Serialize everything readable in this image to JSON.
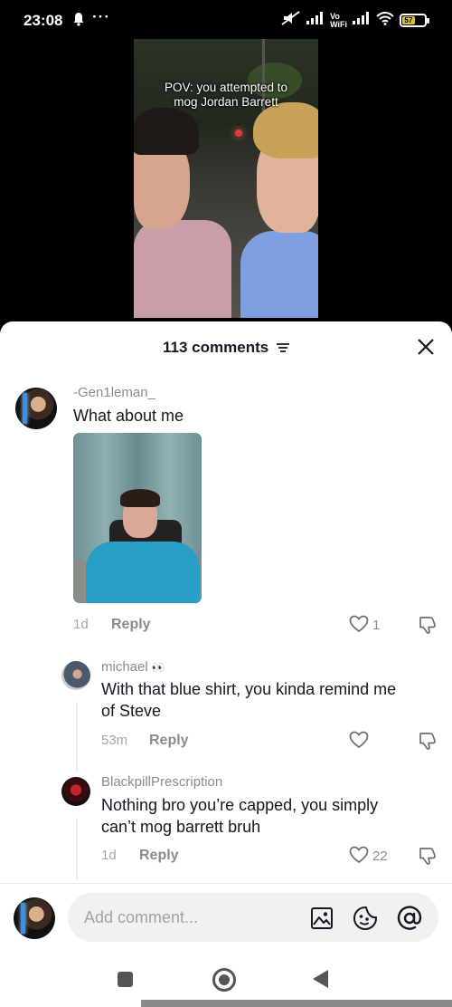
{
  "status_bar": {
    "time": "23:08",
    "dots": "···",
    "vowifi_top": "Vo",
    "vowifi_bottom": "WiFi",
    "battery": "57"
  },
  "video": {
    "caption_line1": "POV: you attempted to",
    "caption_line2": "mog Jordan Barrett"
  },
  "sheet": {
    "comments_count": "113 comments",
    "close_icon": "close-icon",
    "filter_icon": "filter-icon"
  },
  "comments": [
    {
      "username": "-Gen1leman_",
      "text": "What about me",
      "time": "1d",
      "reply_label": "Reply",
      "likes": "1"
    },
    {
      "username": "michael",
      "emoji": "👀",
      "text_line1": "With that blue shirt, you kinda remind me",
      "text_line2": "of Steve",
      "time": "53m",
      "reply_label": "Reply",
      "likes": ""
    },
    {
      "username": "BlackpillPrescription",
      "text_line1": "Nothing bro you’re capped, you simply",
      "text_line2": "can’t mog barrett bruh",
      "time": "1d",
      "reply_label": "Reply",
      "likes": "22"
    }
  ],
  "composer": {
    "placeholder": "Add comment..."
  },
  "colors": {
    "text_primary": "#161823",
    "text_secondary": "#8a8b91",
    "sheet_bg": "#ffffff",
    "input_bg": "#f1f1f2"
  }
}
